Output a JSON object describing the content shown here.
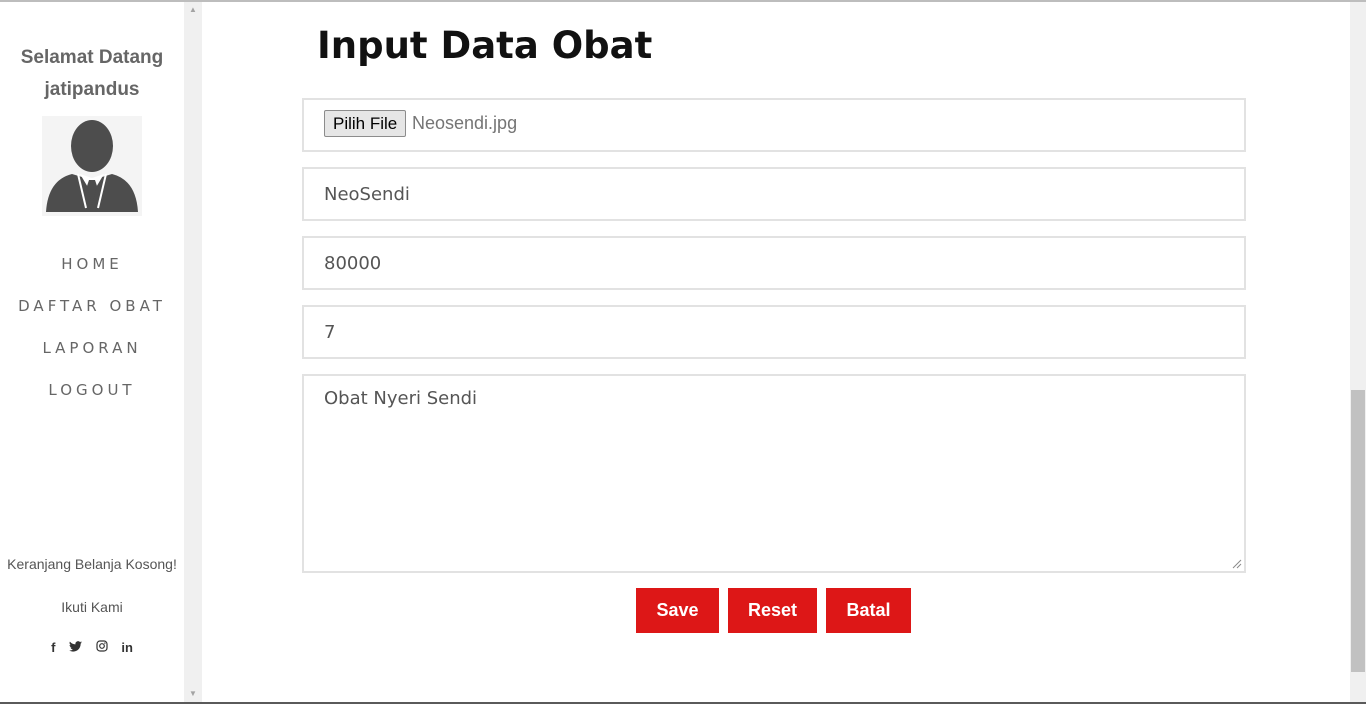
{
  "sidebar": {
    "welcome_line1": "Selamat Datang",
    "welcome_line2": "jatipandus",
    "nav": [
      {
        "label": "HOME"
      },
      {
        "label": "DAFTAR OBAT"
      },
      {
        "label": "LAPORAN"
      },
      {
        "label": "LOGOUT"
      }
    ],
    "cart_text": "Keranjang Belanja Kosong!",
    "follow_text": "Ikuti Kami",
    "social_icons": [
      "facebook-icon",
      "twitter-icon",
      "instagram-icon",
      "linkedin-icon"
    ]
  },
  "form": {
    "title": "Input Data Obat",
    "file_button_label": "Pilih File",
    "file_name": "Neosendi.jpg",
    "name_value": "NeoSendi",
    "price_value": "80000",
    "stock_value": "7",
    "description_value": "Obat Nyeri Sendi",
    "save_label": "Save",
    "reset_label": "Reset",
    "cancel_label": "Batal"
  },
  "colors": {
    "button_red": "#dd1717",
    "text_gray": "#666666"
  }
}
